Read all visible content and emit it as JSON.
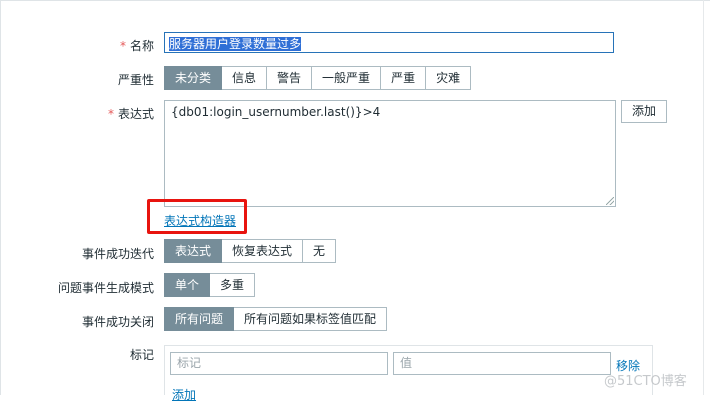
{
  "form": {
    "name_label": "名称",
    "name_value": "服务器用户登录数量过多",
    "severity_label": "严重性",
    "severity_options": [
      "未分类",
      "信息",
      "警告",
      "一般严重",
      "严重",
      "灾难"
    ],
    "expression_label": "表达式",
    "expression_value": "{db01:login_usernumber.last()}>4",
    "add_button": "添加",
    "expression_builder_link": "表达式构造器",
    "ok_event_label": "事件成功迭代",
    "ok_event_options": [
      "表达式",
      "恢复表达式",
      "无"
    ],
    "problem_mode_label": "问题事件生成模式",
    "problem_mode_options": [
      "单个",
      "多重"
    ],
    "ok_close_label": "事件成功关闭",
    "ok_close_options": [
      "所有问题",
      "所有问题如果标签值匹配"
    ],
    "tags_label": "标记",
    "tag_name_placeholder": "标记",
    "tag_value_placeholder": "值",
    "remove_link": "移除",
    "add_tag_link": "添加"
  },
  "watermark": "@51CTO博客",
  "colors": {
    "selected": "#768d99",
    "link": "#0275b8",
    "required": "#e45959",
    "highlight_box": "#e8140f"
  }
}
